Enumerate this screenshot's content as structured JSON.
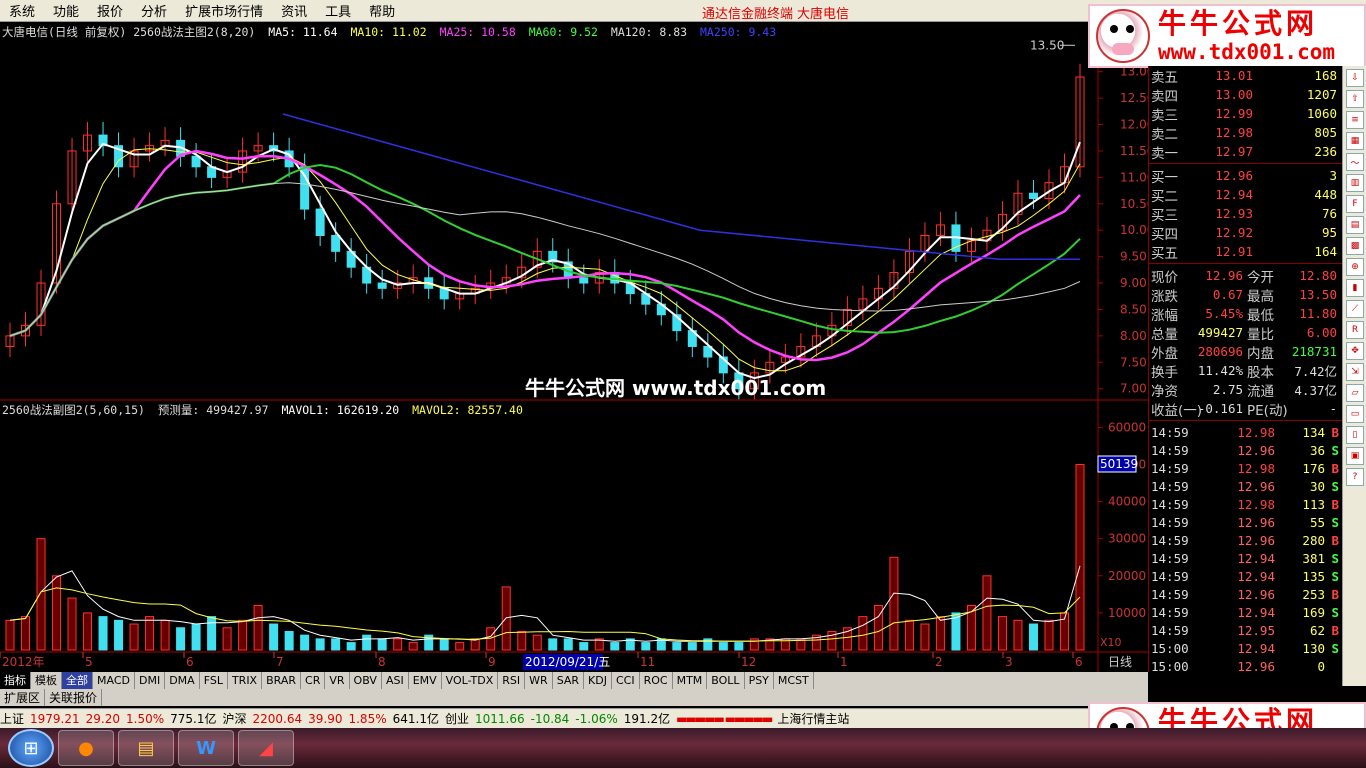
{
  "menu": [
    "系统",
    "功能",
    "报价",
    "分析",
    "扩展市场行情",
    "资讯",
    "工具",
    "帮助"
  ],
  "menu_brand": {
    "broker": "通达信金融终端",
    "stock": "大唐电信"
  },
  "main_info": {
    "title": "大唐电信(日线 前复权) 2560战法主图2(8,20)",
    "ma5": "MA5: 11.64",
    "ma10": "MA10: 11.02",
    "ma25": "MA25: 10.58",
    "ma60": "MA60: 9.52",
    "ma120": "MA120: 8.83",
    "ma250": "MA250: 9.43"
  },
  "sub_info": {
    "title": "2560战法副图2(5,60,15)",
    "pred": "预测量: 499427.97",
    "mavol1": "MAVOL1: 162619.20",
    "mavol2": "MAVOL2: 82557.40"
  },
  "price_axis": [
    "13.00",
    "12.50",
    "12.00",
    "11.50",
    "11.00",
    "10.50",
    "10.00",
    "9.50",
    "9.00",
    "8.50",
    "8.00",
    "7.50",
    "7.00"
  ],
  "vol_axis": [
    "60000",
    "50000",
    "40000",
    "30000",
    "20000",
    "10000"
  ],
  "high_label": "13.50",
  "vol_cursor": "50139",
  "x10_label": "X10",
  "date_axis": [
    "2012年",
    "5",
    "6",
    "7",
    "8",
    "9",
    "11",
    "12",
    "1",
    "2",
    "3",
    "6"
  ],
  "date_cursor": "2012/09/21/五",
  "period_label": "日线",
  "tabs_row1": [
    "指标",
    "模板",
    "全部",
    "MACD",
    "DMI",
    "DMA",
    "FSL",
    "TRIX",
    "BRAR",
    "CR",
    "VR",
    "OBV",
    "ASI",
    "EMV",
    "VOL-TDX",
    "RSI",
    "WR",
    "SAR",
    "KDJ",
    "CCI",
    "ROC",
    "MTM",
    "BOLL",
    "PSY",
    "MCST"
  ],
  "tabs_row2": [
    "扩展区",
    "关联报价"
  ],
  "quote_sell": [
    {
      "l": "卖五",
      "p": "13.01",
      "v": "168"
    },
    {
      "l": "卖四",
      "p": "13.00",
      "v": "1207"
    },
    {
      "l": "卖三",
      "p": "12.99",
      "v": "1060"
    },
    {
      "l": "卖二",
      "p": "12.98",
      "v": "805"
    },
    {
      "l": "卖一",
      "p": "12.97",
      "v": "236"
    }
  ],
  "quote_buy": [
    {
      "l": "买一",
      "p": "12.96",
      "v": "3"
    },
    {
      "l": "买二",
      "p": "12.94",
      "v": "448"
    },
    {
      "l": "买三",
      "p": "12.93",
      "v": "76"
    },
    {
      "l": "买四",
      "p": "12.92",
      "v": "95"
    },
    {
      "l": "买五",
      "p": "12.91",
      "v": "164"
    }
  ],
  "stats": [
    {
      "l": "现价",
      "v": "12.96",
      "vc": "#ff4040",
      "l2": "今开",
      "v2": "12.80",
      "v2c": "#ff4040"
    },
    {
      "l": "涨跌",
      "v": "0.67",
      "vc": "#ff4040",
      "l2": "最高",
      "v2": "13.50",
      "v2c": "#ff4040"
    },
    {
      "l": "涨幅",
      "v": "5.45%",
      "vc": "#ff4040",
      "l2": "最低",
      "v2": "11.80",
      "v2c": "#ff4040"
    },
    {
      "l": "总量",
      "v": "499427",
      "vc": "#ffff60",
      "l2": "量比",
      "v2": "6.00",
      "v2c": "#ff4040"
    },
    {
      "l": "外盘",
      "v": "280696",
      "vc": "#ff4040",
      "l2": "内盘",
      "v2": "218731",
      "v2c": "#40ff40"
    },
    {
      "l": "换手",
      "v": "11.42%",
      "vc": "#ddd",
      "l2": "股本",
      "v2": "7.42亿",
      "v2c": "#ddd"
    },
    {
      "l": "净资",
      "v": "2.75",
      "vc": "#ddd",
      "l2": "流通",
      "v2": "4.37亿",
      "v2c": "#ddd"
    },
    {
      "l": "收益(一)",
      "v": "-0.161",
      "vc": "#ddd",
      "l2": "PE(动)",
      "v2": "-",
      "v2c": "#ddd"
    }
  ],
  "ticks": [
    {
      "t": "14:59",
      "p": "12.98",
      "v": "134",
      "b": "B"
    },
    {
      "t": "14:59",
      "p": "12.96",
      "v": "36",
      "b": "S"
    },
    {
      "t": "14:59",
      "p": "12.98",
      "v": "176",
      "b": "B"
    },
    {
      "t": "14:59",
      "p": "12.96",
      "v": "30",
      "b": "S"
    },
    {
      "t": "14:59",
      "p": "12.98",
      "v": "113",
      "b": "B"
    },
    {
      "t": "14:59",
      "p": "12.96",
      "v": "55",
      "b": "S"
    },
    {
      "t": "14:59",
      "p": "12.96",
      "v": "280",
      "b": "B"
    },
    {
      "t": "14:59",
      "p": "12.94",
      "v": "381",
      "b": "S"
    },
    {
      "t": "14:59",
      "p": "12.94",
      "v": "135",
      "b": "S"
    },
    {
      "t": "14:59",
      "p": "12.96",
      "v": "253",
      "b": "B"
    },
    {
      "t": "14:59",
      "p": "12.94",
      "v": "169",
      "b": "S"
    },
    {
      "t": "14:59",
      "p": "12.95",
      "v": "62",
      "b": "B"
    },
    {
      "t": "15:00",
      "p": "12.94",
      "v": "130",
      "b": "S"
    },
    {
      "t": "15:00",
      "p": "12.96",
      "v": "0",
      "b": ""
    }
  ],
  "statusbar": {
    "sh": "上证",
    "sh_v": "1979.21",
    "sh_c": "29.20",
    "sh_p": "1.50%",
    "sh_a": "775.1亿",
    "sz": "沪深",
    "sz_v": "2200.64",
    "sz_c": "39.90",
    "sz_p": "1.85%",
    "sz_a": "641.1亿",
    "cy": "创业",
    "cy_v": "1011.66",
    "cy_c": "-10.84",
    "cy_p": "-1.06%",
    "cy_a": "191.2亿",
    "station": "上海行情主站"
  },
  "watermark": "牛牛公式网 www.tdx001.com",
  "logo": {
    "t1": "牛牛公式网",
    "t2": "www.tdx001.com"
  },
  "rtool_icons": [
    "arrow-down-icon",
    "arrow-up-icon",
    "list-icon",
    "chart-icon",
    "line-chart-icon",
    "bar-chart-icon",
    "f10-icon",
    "table-icon",
    "grid-icon",
    "zoom-icon",
    "candle-icon",
    "trend-icon",
    "rsi-icon",
    "compass-icon",
    "move-icon",
    "chart-small-icon",
    "file-icon",
    "doc-icon",
    "cal-icon",
    "help-icon"
  ],
  "chart_data": {
    "type": "candlestick",
    "title": "大唐电信(日线 前复权)",
    "ylim": [
      6.9,
      13.6
    ],
    "ma": {
      "MA5": 11.64,
      "MA10": 11.02,
      "MA25": 10.58,
      "MA60": 9.52,
      "MA120": 8.83,
      "MA250": 9.43
    },
    "close_points": [
      8.0,
      8.2,
      9.0,
      10.5,
      11.5,
      11.8,
      11.6,
      11.2,
      11.5,
      11.6,
      11.7,
      11.4,
      11.2,
      11.0,
      11.1,
      11.5,
      11.6,
      11.5,
      11.2,
      10.4,
      9.9,
      9.6,
      9.3,
      9.0,
      8.9,
      9.0,
      9.1,
      8.9,
      8.7,
      8.8,
      8.9,
      9.0,
      9.1,
      9.3,
      9.6,
      9.4,
      9.1,
      9.0,
      9.2,
      9.0,
      8.8,
      8.6,
      8.4,
      8.1,
      7.8,
      7.6,
      7.3,
      7.0,
      7.3,
      7.5,
      7.6,
      7.8,
      8.0,
      8.2,
      8.5,
      8.7,
      8.9,
      9.2,
      9.6,
      9.9,
      10.1,
      9.6,
      9.8,
      10.0,
      10.3,
      10.7,
      10.6,
      10.9,
      11.2,
      12.9
    ],
    "volume_points": [
      8000,
      9000,
      30000,
      20000,
      14000,
      10000,
      9000,
      8000,
      7000,
      9000,
      8000,
      6000,
      7000,
      9000,
      6000,
      8000,
      12000,
      7000,
      5000,
      4000,
      3000,
      3000,
      2000,
      4000,
      3000,
      3000,
      2000,
      4000,
      3000,
      2000,
      3000,
      6000,
      17000,
      5000,
      4000,
      3000,
      3000,
      2000,
      3000,
      2000,
      3000,
      2000,
      3000,
      2000,
      2000,
      3000,
      2000,
      2000,
      3000,
      3000,
      3000,
      3000,
      4000,
      5000,
      6000,
      9000,
      12000,
      25000,
      8000,
      7000,
      9000,
      10000,
      12000,
      20000,
      9000,
      8000,
      7000,
      8000,
      10000,
      50000
    ]
  }
}
